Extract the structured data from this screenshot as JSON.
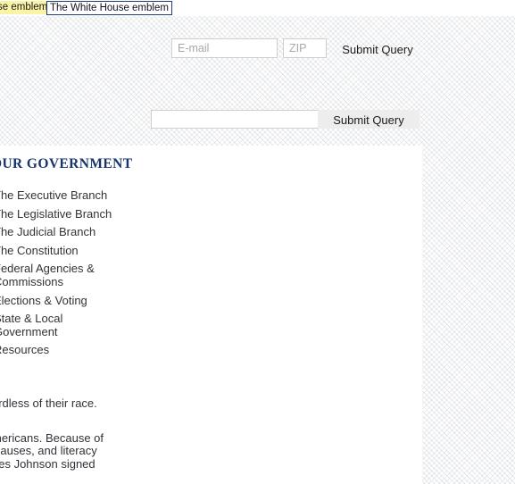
{
  "annotation": {
    "highlight_label": "se emblem",
    "tooltip_text": "The White House emblem"
  },
  "signup_form": {
    "email_placeholder": "E-mail",
    "zip_placeholder": "ZIP",
    "submit_label": "Submit Query"
  },
  "search_form": {
    "keyword_value": "",
    "keyword_placeholder": "",
    "submit_label": "Submit Query"
  },
  "content": {
    "heading": "OUR\nGOVERNMENT",
    "nav_items": [
      {
        "label": "The Executive Branch"
      },
      {
        "label": "The Legislative Branch"
      },
      {
        "label": "The Judicial Branch"
      },
      {
        "label": "The Constitution"
      },
      {
        "label": "Federal Agencies &\nCommissions"
      },
      {
        "label": "Elections & Voting"
      },
      {
        "label": "State & Local\nGovernment"
      },
      {
        "label": "Resources"
      }
    ],
    "paragraphs": [
      "ardless of their race.",
      "mericans. Because of\nclauses, and literacy\nnes Johnson signed"
    ]
  },
  "colors": {
    "heading_navy": "#17356b",
    "tooltip_border": "#1f3f74",
    "highlight_yellow": "#fbf3a6",
    "button_gray": "#ededed",
    "body_text": "#2f3338"
  }
}
